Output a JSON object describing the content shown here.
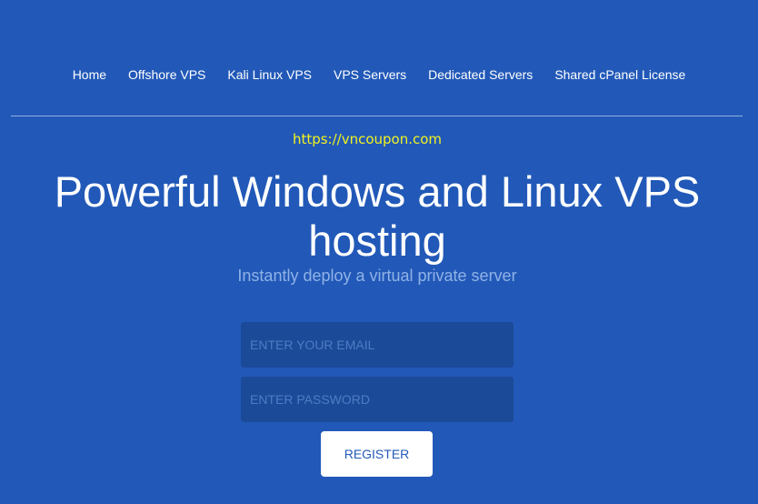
{
  "nav": {
    "items": [
      {
        "label": "Home"
      },
      {
        "label": "Offshore VPS"
      },
      {
        "label": "Kali Linux VPS"
      },
      {
        "label": "VPS Servers"
      },
      {
        "label": "Dedicated Servers"
      },
      {
        "label": "Shared cPanel License"
      }
    ]
  },
  "watermark": {
    "text": "https://vncoupon.com",
    "color": "#f3f21f"
  },
  "hero": {
    "title": "Powerful Windows and Linux VPS hosting",
    "subtitle": "Instantly deploy a virtual private server"
  },
  "form": {
    "email_placeholder": "ENTER YOUR EMAIL",
    "email_value": "",
    "password_placeholder": "ENTER PASSWORD",
    "password_value": "",
    "register_label": "REGISTER"
  },
  "colors": {
    "background": "#2259b8",
    "field_background": "#1b4a98",
    "subtitle": "#8fb2e6"
  }
}
